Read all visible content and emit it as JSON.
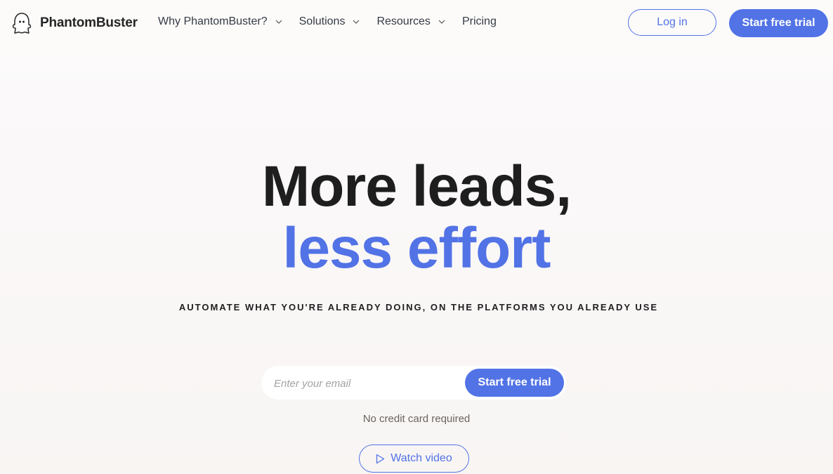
{
  "brand": {
    "name": "PhantomBuster",
    "logo_icon": "ghost-icon",
    "accent_color": "#5273e6"
  },
  "nav": {
    "items": [
      {
        "label": "Why PhantomBuster?",
        "has_dropdown": true,
        "icon": "chevron-down-icon"
      },
      {
        "label": "Solutions",
        "has_dropdown": true,
        "icon": "chevron-down-icon"
      },
      {
        "label": "Resources",
        "has_dropdown": true,
        "icon": "chevron-down-icon"
      },
      {
        "label": "Pricing",
        "has_dropdown": false
      }
    ],
    "login_label": "Log in",
    "trial_label": "Start free trial"
  },
  "hero": {
    "title_line1": "More leads,",
    "title_line2": "less effort",
    "subtitle": "AUTOMATE WHAT YOU'RE ALREADY DOING, ON THE PLATFORMS YOU ALREADY USE",
    "email_placeholder": "Enter your email",
    "email_value": "",
    "form_button_label": "Start free trial",
    "note": "No credit card required",
    "video_button_label": "Watch video",
    "video_icon": "play-icon"
  }
}
